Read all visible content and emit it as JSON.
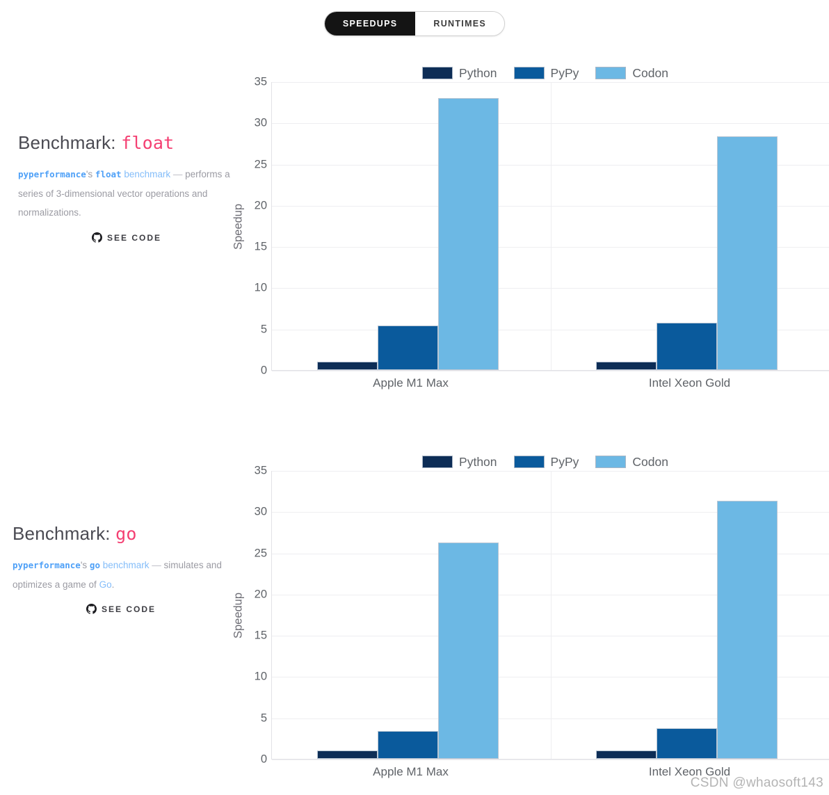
{
  "toggle": {
    "active_label": "SPEEDUPS",
    "inactive_label": "RUNTIMES"
  },
  "benchmarks": [
    {
      "title_prefix": "Benchmark: ",
      "title_name": "float",
      "desc_link1": "pyperformance",
      "desc_possessive": "'s ",
      "desc_link2": "float",
      "desc_link3": " benchmark",
      "desc_dash": " — ",
      "desc_rest": "performs a series of 3-dimensional vector operations and normalizations.",
      "see_code_label": "SEE CODE"
    },
    {
      "title_prefix": "Benchmark: ",
      "title_name": "go",
      "desc_link1": "pyperformance",
      "desc_possessive": "'s ",
      "desc_link2": "go",
      "desc_link3": " benchmark",
      "desc_dash": " — ",
      "desc_rest": "simulates and optimizes a game of ",
      "desc_rest_link": "Go",
      "desc_period": ".",
      "see_code_label": "SEE CODE"
    }
  ],
  "colors": {
    "python": "#0d2d56",
    "pypy": "#0a5a9c",
    "codon": "#6cb8e4",
    "accent_pink": "#f43f72",
    "link_blue": "#4ea0f7",
    "toggle_on_bg": "#141414"
  },
  "watermark": "CSDN @whaosoft143",
  "chart_data": [
    {
      "type": "bar",
      "title": "",
      "benchmark": "float",
      "categories": [
        "Apple M1 Max",
        "Intel Xeon Gold"
      ],
      "series": [
        {
          "name": "Python",
          "color": "#0d2d56",
          "values": [
            1.0,
            1.0
          ]
        },
        {
          "name": "PyPy",
          "color": "#0a5a9c",
          "values": [
            5.4,
            5.7
          ]
        },
        {
          "name": "Codon",
          "color": "#6cb8e4",
          "values": [
            33.0,
            28.3
          ]
        }
      ],
      "xlabel": "",
      "ylabel": "Speedup",
      "ylim": [
        0,
        35
      ],
      "yticks": [
        0,
        5,
        10,
        15,
        20,
        25,
        30,
        35
      ],
      "grid": true,
      "legend_position": "top"
    },
    {
      "type": "bar",
      "title": "",
      "benchmark": "go",
      "categories": [
        "Apple M1 Max",
        "Intel Xeon Gold"
      ],
      "series": [
        {
          "name": "Python",
          "color": "#0d2d56",
          "values": [
            1.0,
            1.0
          ]
        },
        {
          "name": "PyPy",
          "color": "#0a5a9c",
          "values": [
            3.4,
            3.7
          ]
        },
        {
          "name": "Codon",
          "color": "#6cb8e4",
          "values": [
            26.2,
            31.3
          ]
        }
      ],
      "xlabel": "",
      "ylabel": "Speedup",
      "ylim": [
        0,
        35
      ],
      "yticks": [
        0,
        5,
        10,
        15,
        20,
        25,
        30,
        35
      ],
      "grid": true,
      "legend_position": "top"
    }
  ]
}
